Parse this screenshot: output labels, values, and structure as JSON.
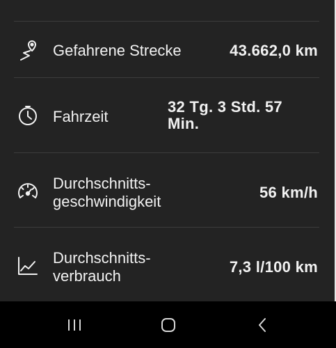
{
  "stats": [
    {
      "label": "Gefahrene Strecke",
      "value": "43.662,0 km",
      "icon": "route-pin-icon"
    },
    {
      "label": "Fahrzeit",
      "value": "32 Tg. 3 Std. 57 Min.",
      "icon": "clock-icon"
    },
    {
      "label": "Durchschnitts-geschwindigkeit",
      "value": "56 km/h",
      "icon": "speedometer-icon"
    },
    {
      "label": "Durchschnitts-verbrauch",
      "value": "7,3 l/100 km",
      "icon": "consumption-chart-icon"
    }
  ],
  "navbar": {
    "recents_icon": "recents-icon",
    "home_icon": "home-icon",
    "back_icon": "back-icon"
  },
  "colors": {
    "background": "#232323",
    "text": "#f2f2f2",
    "divider": "#3c3c3c",
    "navbar": "#000000"
  }
}
